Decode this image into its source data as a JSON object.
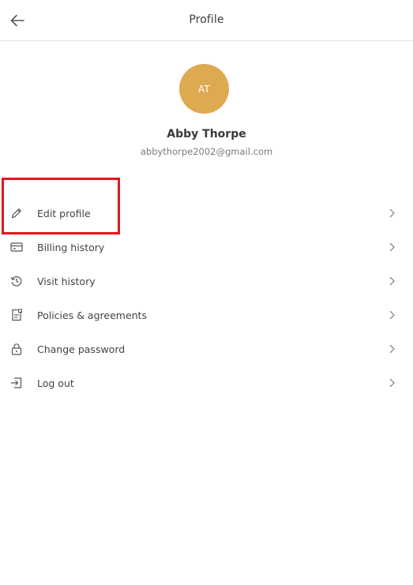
{
  "header": {
    "title": "Profile",
    "back_icon": "arrow-left-icon"
  },
  "profile": {
    "initials": "AT",
    "avatar_color": "#deaa50",
    "name": "Abby Thorpe",
    "email": "abbythorpe2002@gmail.com"
  },
  "menu": {
    "items": [
      {
        "label": "Edit profile",
        "icon": "pencil-icon"
      },
      {
        "label": "Billing history",
        "icon": "credit-card-icon"
      },
      {
        "label": "Visit history",
        "icon": "history-icon"
      },
      {
        "label": "Policies & agreements",
        "icon": "document-icon"
      },
      {
        "label": "Change password",
        "icon": "lock-icon"
      },
      {
        "label": "Log out",
        "icon": "logout-icon"
      }
    ],
    "chevron_icon": "chevron-right-icon"
  },
  "annotation": {
    "color": "#e8141b"
  }
}
